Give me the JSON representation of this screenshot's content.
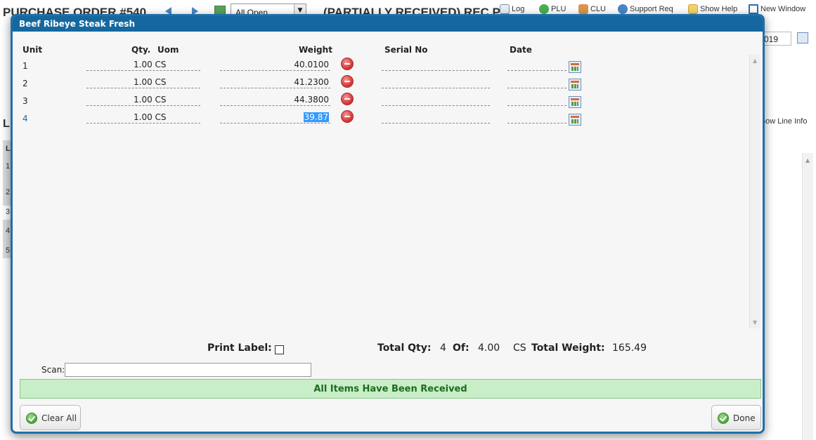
{
  "background": {
    "page_title": "PURCHASE ORDER #540",
    "filter_select": "All Open",
    "status_text": "(PARTIALLY RECEIVED) REC PO",
    "toolbar": [
      {
        "label": "Log",
        "icon": "log-icon"
      },
      {
        "label": "PLU",
        "icon": "dollar-icon"
      },
      {
        "label": "CLU",
        "icon": "users-icon"
      },
      {
        "label": "Support Req",
        "icon": "help-circle-icon"
      },
      {
        "label": "Show Help",
        "icon": "speech-bubble-icon"
      },
      {
        "label": "New Window",
        "icon": "window-icon"
      }
    ],
    "date_fragment": "019",
    "show_line_info": "how Line Info",
    "left_heading": "L",
    "left_rows": [
      "L",
      "1",
      "2",
      "3",
      "4",
      "5"
    ]
  },
  "modal": {
    "title": "Beef Ribeye Steak Fresh",
    "columns": {
      "unit": "Unit",
      "qty": "Qty.",
      "uom": "Uom",
      "weight": "Weight",
      "serial": "Serial No",
      "date": "Date"
    },
    "rows": [
      {
        "unit": "1",
        "qty_uom": "1.00 CS",
        "weight": "40.0100",
        "serial": "",
        "date": ""
      },
      {
        "unit": "2",
        "qty_uom": "1.00 CS",
        "weight": "41.2300",
        "serial": "",
        "date": ""
      },
      {
        "unit": "3",
        "qty_uom": "1.00 CS",
        "weight": "44.3800",
        "serial": "",
        "date": ""
      },
      {
        "unit": "4",
        "qty_uom": "1.00 CS",
        "weight": "39.87",
        "serial": "",
        "date": ""
      }
    ],
    "print_label": "Print Label:",
    "total_qty_label": "Total Qty:",
    "total_qty": "4",
    "of_label": "Of:",
    "of_value": "4.00",
    "of_uom": "CS",
    "total_weight_label": "Total Weight:",
    "total_weight": "165.49",
    "scan_label": "Scan:",
    "scan_value": "",
    "banner": "All Items Have Been Received",
    "clear_button": "Clear All",
    "done_button": "Done",
    "colors": {
      "header": "#14689f",
      "banner_bg": "#c8eec7",
      "banner_text": "#1e6b1e",
      "selection": "#3399ff"
    }
  }
}
